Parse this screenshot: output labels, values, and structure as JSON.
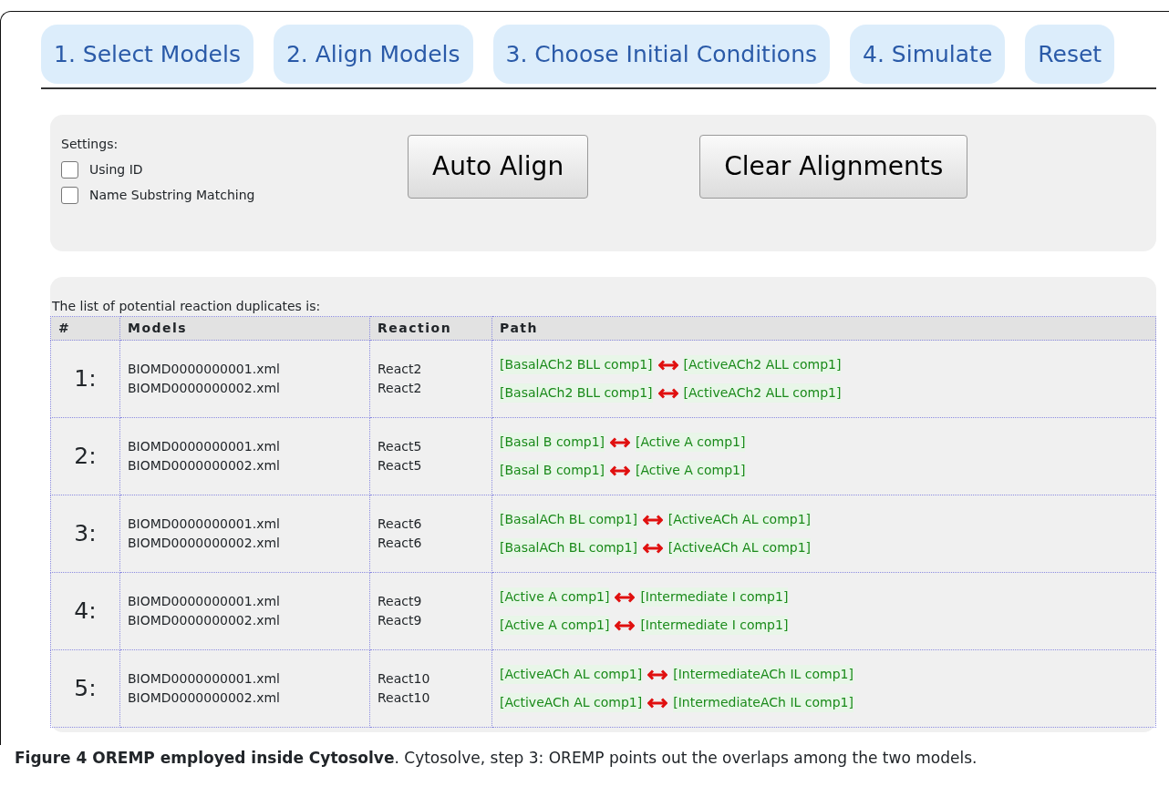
{
  "tabs": [
    {
      "label": "1. Select Models"
    },
    {
      "label": "2. Align Models"
    },
    {
      "label": "3. Choose Initial Conditions"
    },
    {
      "label": "4. Simulate"
    },
    {
      "label": "Reset"
    }
  ],
  "settings": {
    "title": "Settings:",
    "options": [
      {
        "label": "Using ID",
        "checked": false
      },
      {
        "label": "Name Substring Matching",
        "checked": false
      }
    ],
    "buttons": [
      "Auto Align",
      "Clear Alignments"
    ]
  },
  "duplicates": {
    "intro": "The list of potential reaction duplicates is:",
    "columns": [
      "#",
      "Models",
      "Reaction",
      "Path"
    ],
    "rows": [
      {
        "number": "1:",
        "models": [
          "BIOMD0000000001.xml",
          "BIOMD0000000002.xml"
        ],
        "reactions": [
          "React2",
          "React2"
        ],
        "paths": [
          {
            "from": "[BasalACh2 BLL comp1]",
            "to": "[ActiveACh2 ALL comp1]"
          },
          {
            "from": "[BasalACh2 BLL comp1]",
            "to": "[ActiveACh2 ALL comp1]"
          }
        ]
      },
      {
        "number": "2:",
        "models": [
          "BIOMD0000000001.xml",
          "BIOMD0000000002.xml"
        ],
        "reactions": [
          "React5",
          "React5"
        ],
        "paths": [
          {
            "from": "[Basal B comp1]",
            "to": "[Active A comp1]"
          },
          {
            "from": "[Basal B comp1]",
            "to": "[Active A comp1]"
          }
        ]
      },
      {
        "number": "3:",
        "models": [
          "BIOMD0000000001.xml",
          "BIOMD0000000002.xml"
        ],
        "reactions": [
          "React6",
          "React6"
        ],
        "paths": [
          {
            "from": "[BasalACh BL comp1]",
            "to": "[ActiveACh AL comp1]"
          },
          {
            "from": "[BasalACh BL comp1]",
            "to": "[ActiveACh AL comp1]"
          }
        ]
      },
      {
        "number": "4:",
        "models": [
          "BIOMD0000000001.xml",
          "BIOMD0000000002.xml"
        ],
        "reactions": [
          "React9",
          "React9"
        ],
        "paths": [
          {
            "from": "[Active A comp1]",
            "to": "[Intermediate I comp1]"
          },
          {
            "from": "[Active A comp1]",
            "to": "[Intermediate I comp1]"
          }
        ]
      },
      {
        "number": "5:",
        "models": [
          "BIOMD0000000001.xml",
          "BIOMD0000000002.xml"
        ],
        "reactions": [
          "React10",
          "React10"
        ],
        "paths": [
          {
            "from": "[ActiveACh AL comp1]",
            "to": "[IntermediateACh IL comp1]"
          },
          {
            "from": "[ActiveACh AL comp1]",
            "to": "[IntermediateACh IL comp1]"
          }
        ]
      }
    ]
  },
  "caption": "**Figure 4 OREMP employed inside Cytosolve**. Cytosolve, step 3: OREMP points out the overlaps among the two models."
}
